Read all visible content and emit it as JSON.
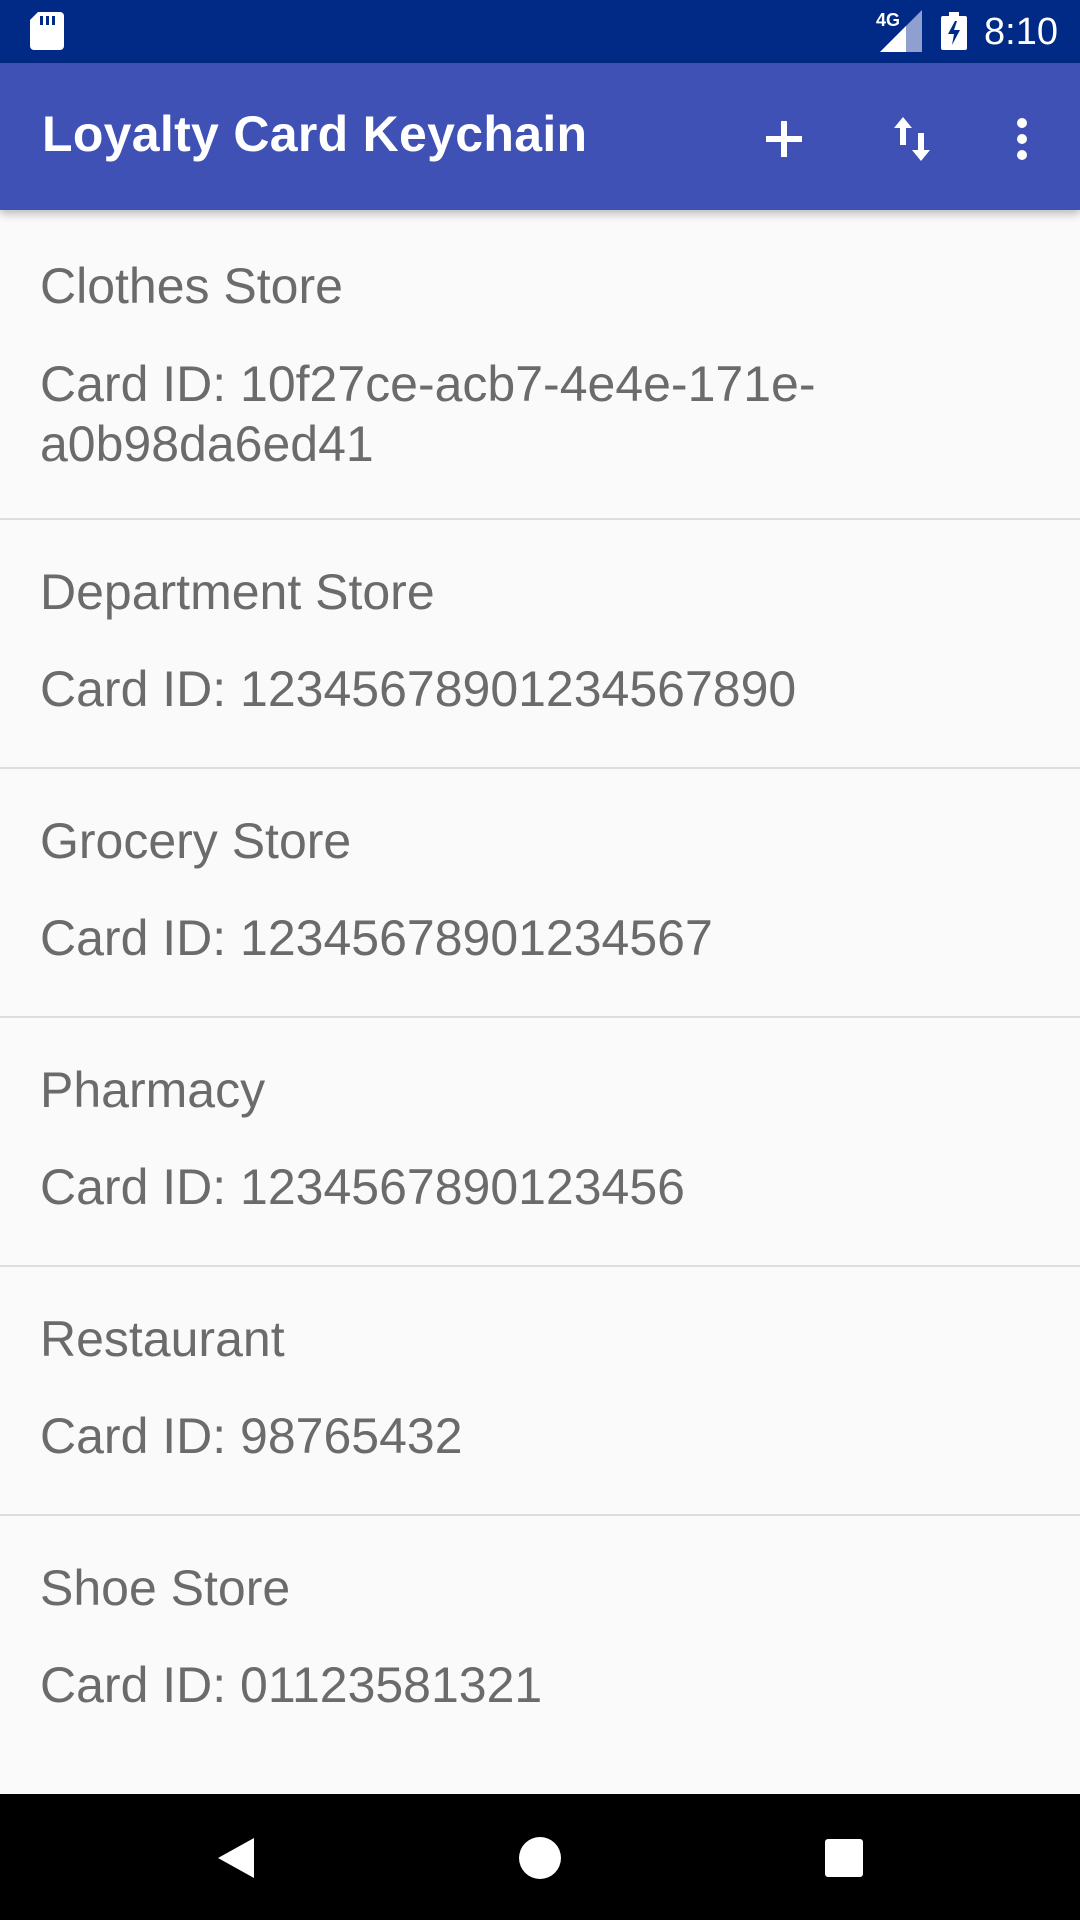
{
  "status_bar": {
    "network_label": "4G",
    "time": "8:10",
    "icons": [
      "sd-card-icon",
      "signal-icon",
      "battery-icon"
    ]
  },
  "app_bar": {
    "title": "Loyalty Card Keychain",
    "actions": [
      {
        "name": "add-card-button",
        "icon": "plus-icon"
      },
      {
        "name": "sort-button",
        "icon": "sort-arrows-icon"
      },
      {
        "name": "overflow-menu-button",
        "icon": "more-vert-icon"
      }
    ]
  },
  "cards": [
    {
      "store": "Clothes Store",
      "card_id_line1": "Card ID: 10f27ce-acb7-4e4e-171e-",
      "card_id_line2": "a0b98da6ed41"
    },
    {
      "store": "Department Store",
      "card_id": "Card ID: 12345678901234567890"
    },
    {
      "store": "Grocery Store",
      "card_id": "Card ID: 12345678901234567"
    },
    {
      "store": "Pharmacy",
      "card_id": "Card ID: 1234567890123456"
    },
    {
      "store": "Restaurant",
      "card_id": "Card ID: 98765432"
    },
    {
      "store": "Shoe Store",
      "card_id": "Card ID: 01123581321"
    }
  ],
  "nav_bar": {
    "buttons": [
      "back-icon",
      "home-icon",
      "recents-icon"
    ]
  },
  "colors": {
    "status_bar": "#002a85",
    "app_bar": "#3f51b5",
    "background": "#fafafa",
    "text": "#6b6b6b",
    "divider": "#dddddd",
    "nav_bar": "#000000"
  }
}
